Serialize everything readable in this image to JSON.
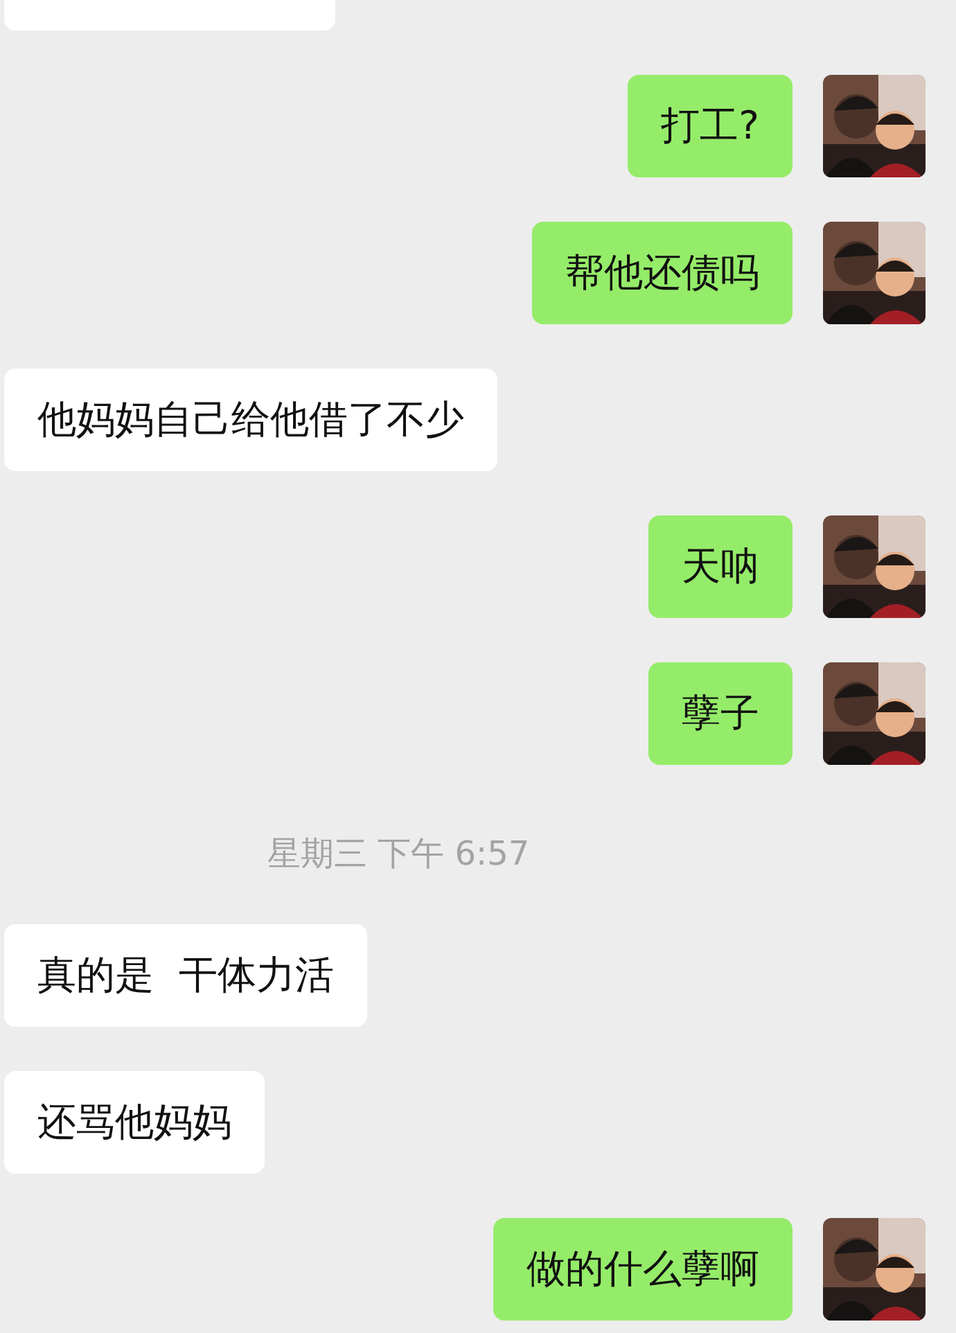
{
  "messages": [
    {
      "outgoing": false,
      "kind": "cut"
    },
    {
      "outgoing": true,
      "kind": "text",
      "text": "打工?"
    },
    {
      "outgoing": true,
      "kind": "text",
      "text": "帮他还债吗"
    },
    {
      "outgoing": false,
      "kind": "text",
      "text": "他妈妈自己给他借了不少"
    },
    {
      "outgoing": true,
      "kind": "text",
      "text": "天呐"
    },
    {
      "outgoing": true,
      "kind": "text",
      "text": "孽子"
    },
    {
      "kind": "time",
      "text": "星期三 下午 6:57"
    },
    {
      "outgoing": false,
      "kind": "text",
      "text": "真的是  干体力活"
    },
    {
      "outgoing": false,
      "kind": "text",
      "text": "还骂他妈妈"
    },
    {
      "outgoing": true,
      "kind": "text",
      "text": "做的什么孽啊"
    }
  ]
}
